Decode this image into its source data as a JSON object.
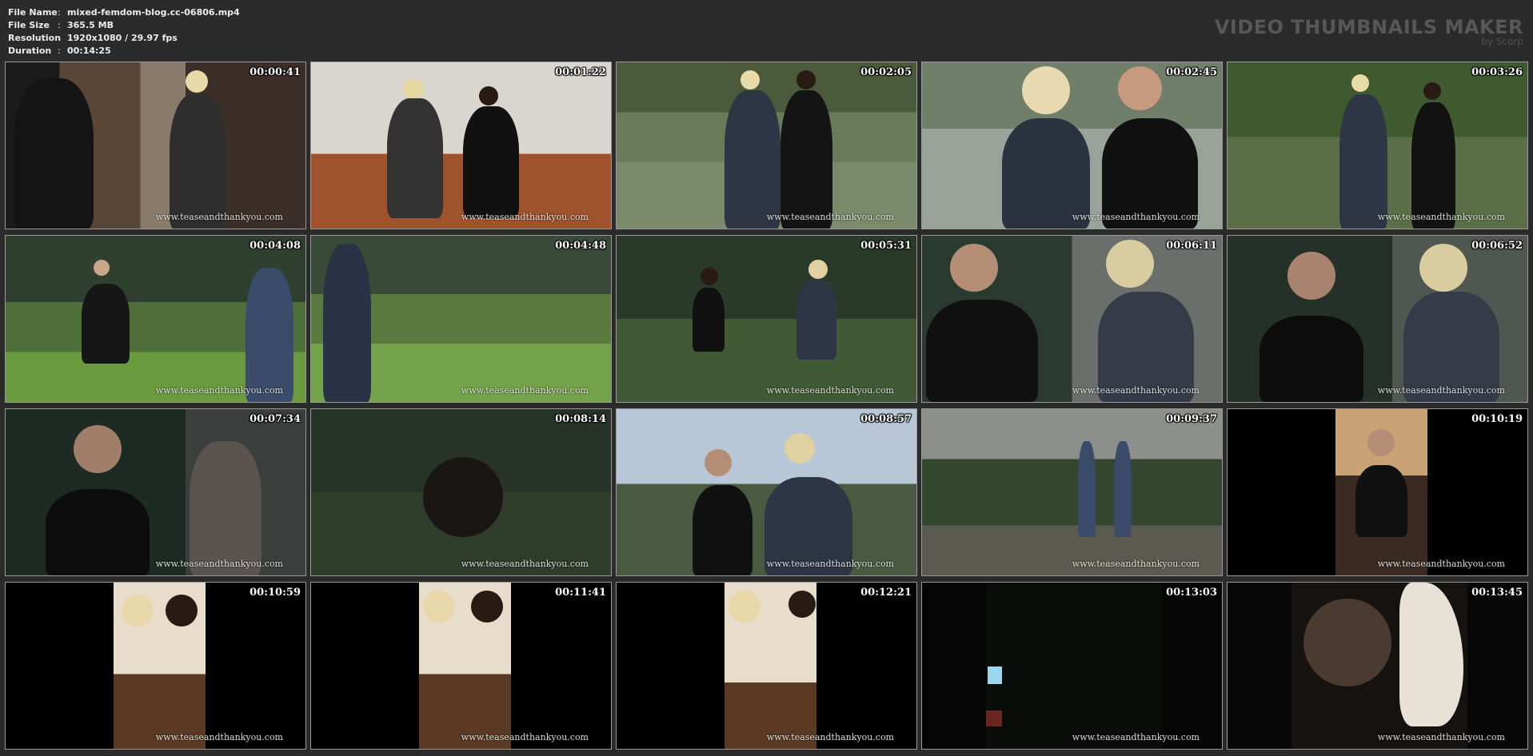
{
  "file_info": {
    "rows": [
      {
        "key": "File Name",
        "value": "mixed-femdom-blog.cc-06806.mp4"
      },
      {
        "key": "File Size",
        "value": "365.5 MB"
      },
      {
        "key": "Resolution",
        "value": "1920x1080 / 29.97 fps"
      },
      {
        "key": "Duration",
        "value": "00:14:25"
      }
    ],
    "separator": ":"
  },
  "brand": {
    "title": "VIDEO THUMBNAILS MAKER",
    "subtitle": "by Scorp"
  },
  "watermark": "www.teaseandthankyou.com",
  "thumbnails": [
    {
      "time": "00:00:41",
      "scene": "store"
    },
    {
      "time": "00:01:22",
      "scene": "bench"
    },
    {
      "time": "00:02:05",
      "scene": "garden-car"
    },
    {
      "time": "00:02:45",
      "scene": "closeup-pair"
    },
    {
      "time": "00:03:26",
      "scene": "sign-garden"
    },
    {
      "time": "00:04:08",
      "scene": "kneel-garden"
    },
    {
      "time": "00:04:48",
      "scene": "walk-garden"
    },
    {
      "time": "00:05:31",
      "scene": "dusk-bushes"
    },
    {
      "time": "00:06:11",
      "scene": "phone-dusk"
    },
    {
      "time": "00:06:52",
      "scene": "phone-dusk2"
    },
    {
      "time": "00:07:34",
      "scene": "phone-dark"
    },
    {
      "time": "00:08:14",
      "scene": "dark-face"
    },
    {
      "time": "00:08:57",
      "scene": "sky-pair"
    },
    {
      "time": "00:09:37",
      "scene": "path-house"
    },
    {
      "time": "00:10:19",
      "scene": "vertical-table"
    },
    {
      "time": "00:10:59",
      "scene": "vertical-pair"
    },
    {
      "time": "00:11:41",
      "scene": "vertical-pair2"
    },
    {
      "time": "00:12:21",
      "scene": "vertical-pair3"
    },
    {
      "time": "00:13:03",
      "scene": "night"
    },
    {
      "time": "00:13:45",
      "scene": "car-face"
    }
  ],
  "colors": {
    "background": "#2b2b2b",
    "border": "#9a9a9a",
    "info_text": "#ececec",
    "brand_text": "#575757"
  }
}
